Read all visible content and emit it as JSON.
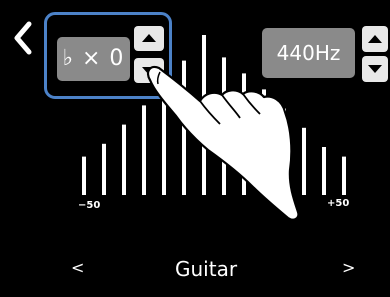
{
  "header": {
    "back_icon": "chevron-left-icon",
    "flat_value": "♭ × 0",
    "flat_up_icon": "triangle-up-icon",
    "flat_down_icon": "triangle-down-icon",
    "calibration_value": "440Hz",
    "calibration_up_icon": "triangle-up-icon",
    "calibration_down_icon": "triangle-down-icon"
  },
  "meter": {
    "min_label": "−50",
    "max_label": "+50",
    "bar_heights_relative": [
      0.24,
      0.32,
      0.44,
      0.56,
      0.7,
      0.84,
      1.0,
      0.86,
      0.76,
      0.66,
      0.54,
      0.42,
      0.3,
      0.24
    ]
  },
  "footer": {
    "prev_label": "<",
    "tuning_type": "Guitar",
    "next_label": ">"
  },
  "colors": {
    "background": "#000000",
    "highlight_frame": "#4c82c8",
    "display_box": "#8a8a8a",
    "button": "#e8e8e8"
  }
}
